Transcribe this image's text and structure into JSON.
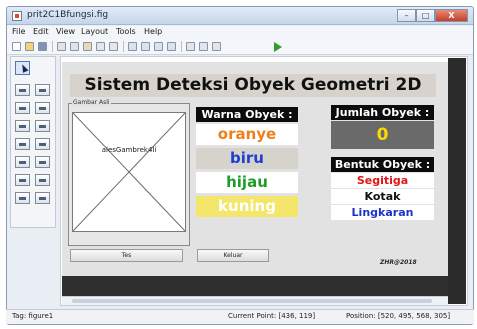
{
  "window": {
    "title": "prit2C1Bfungsi.fig",
    "controls": {
      "minimize": "–",
      "maximize": "□",
      "close": "X"
    }
  },
  "menu": [
    "File",
    "Edit",
    "View",
    "Layout",
    "Tools",
    "Help"
  ],
  "toolbar_icons": [
    "new-icon",
    "open-icon",
    "save-icon",
    "cut-icon",
    "copy-icon",
    "paste-icon",
    "undo-icon",
    "redo-icon",
    "align-icon",
    "menu-editor-icon",
    "tab-order-icon",
    "toolbar-editor-icon",
    "editor-icon",
    "property-inspector-icon",
    "object-browser-icon",
    "run-icon"
  ],
  "palette_icons": [
    "pointer-icon",
    "push-button-icon",
    "slider-icon",
    "radio-button-icon",
    "checkbox-icon",
    "edit-text-icon",
    "static-text-icon",
    "popup-menu-icon",
    "listbox-icon",
    "toggle-button-icon",
    "table-icon",
    "axes-icon",
    "panel-icon",
    "button-group-icon",
    "activex-icon"
  ],
  "gui": {
    "app_title": "Sistem Deteksi Obyek Geometri 2D",
    "image_panel_label": "Gambar Asli",
    "axes_label": "alesGambrek4li",
    "test_button": "Tes",
    "exit_button": "Keluar",
    "color_header": "Warna Obyek :",
    "colors": [
      {
        "label": "oranye",
        "text_color": "#f07f1a",
        "bg": "#ffffff"
      },
      {
        "label": "biru",
        "text_color": "#1f3fd2",
        "bg": "#d6d2cc"
      },
      {
        "label": "hijau",
        "text_color": "#1e9e28",
        "bg": "#ffffff"
      },
      {
        "label": "kuning",
        "text_color": "#ffffff",
        "bg": "#f4e66a"
      }
    ],
    "count_header": "Jumlah Obyek :",
    "count_value": "0",
    "shape_header": "Bentuk Obyek :",
    "shapes": [
      {
        "label": "Segitiga",
        "text_color": "#e21414"
      },
      {
        "label": "Kotak",
        "text_color": "#111111"
      },
      {
        "label": "Lingkaran",
        "text_color": "#1d32c8"
      }
    ],
    "signature": "ZHR@2018"
  },
  "status": {
    "tag": "Tag: figure1",
    "current_point": "Current Point: [436, 119]",
    "position": "Position: [520, 495, 568, 305]"
  },
  "colors": {
    "canvas_bg": "#e2e2e2",
    "dark_frame": "#2b2b2b",
    "label_header_bg": "#0c0c0c",
    "count_bg": "#6a6a6a",
    "count_text": "#ffd800",
    "run_icon": "#2f9f2f"
  }
}
